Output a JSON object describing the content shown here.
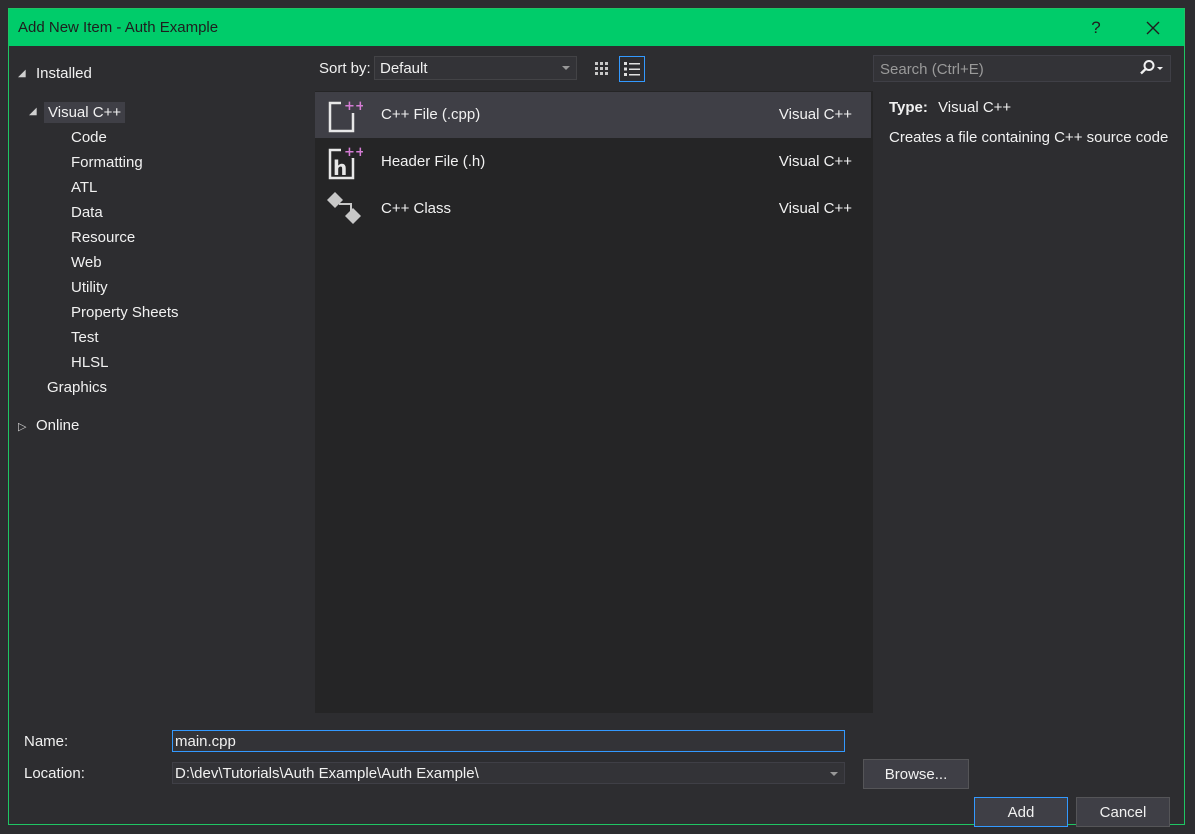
{
  "window": {
    "title": "Add New Item - Auth Example",
    "help_label": "?",
    "close_label": "✕"
  },
  "tree": {
    "installed": "Installed",
    "visual_cpp": "Visual C++",
    "children": [
      "Code",
      "Formatting",
      "ATL",
      "Data",
      "Resource",
      "Web",
      "Utility",
      "Property Sheets",
      "Test",
      "HLSL"
    ],
    "graphics": "Graphics",
    "online": "Online"
  },
  "toolbar": {
    "sort_label": "Sort by:",
    "sort_value": "Default"
  },
  "search": {
    "placeholder": "Search (Ctrl+E)"
  },
  "templates": [
    {
      "name": "C++ File (.cpp)",
      "lang": "Visual C++",
      "icon": "cpp-file-icon",
      "selected": true
    },
    {
      "name": "Header File (.h)",
      "lang": "Visual C++",
      "icon": "header-file-icon",
      "selected": false
    },
    {
      "name": "C++ Class",
      "lang": "Visual C++",
      "icon": "cpp-class-icon",
      "selected": false
    }
  ],
  "details": {
    "type_key": "Type:",
    "type_value": "Visual C++",
    "description": "Creates a file containing C++ source code"
  },
  "form": {
    "name_label": "Name:",
    "name_value": "main.cpp",
    "location_label": "Location:",
    "location_value": "D:\\dev\\Tutorials\\Auth Example\\Auth Example\\",
    "browse_label": "Browse...",
    "add_label": "Add",
    "cancel_label": "Cancel"
  },
  "colors": {
    "title_bar": "#00cc6a",
    "background": "#2d2d30",
    "list_background": "#252526",
    "accent": "#3399ff"
  }
}
